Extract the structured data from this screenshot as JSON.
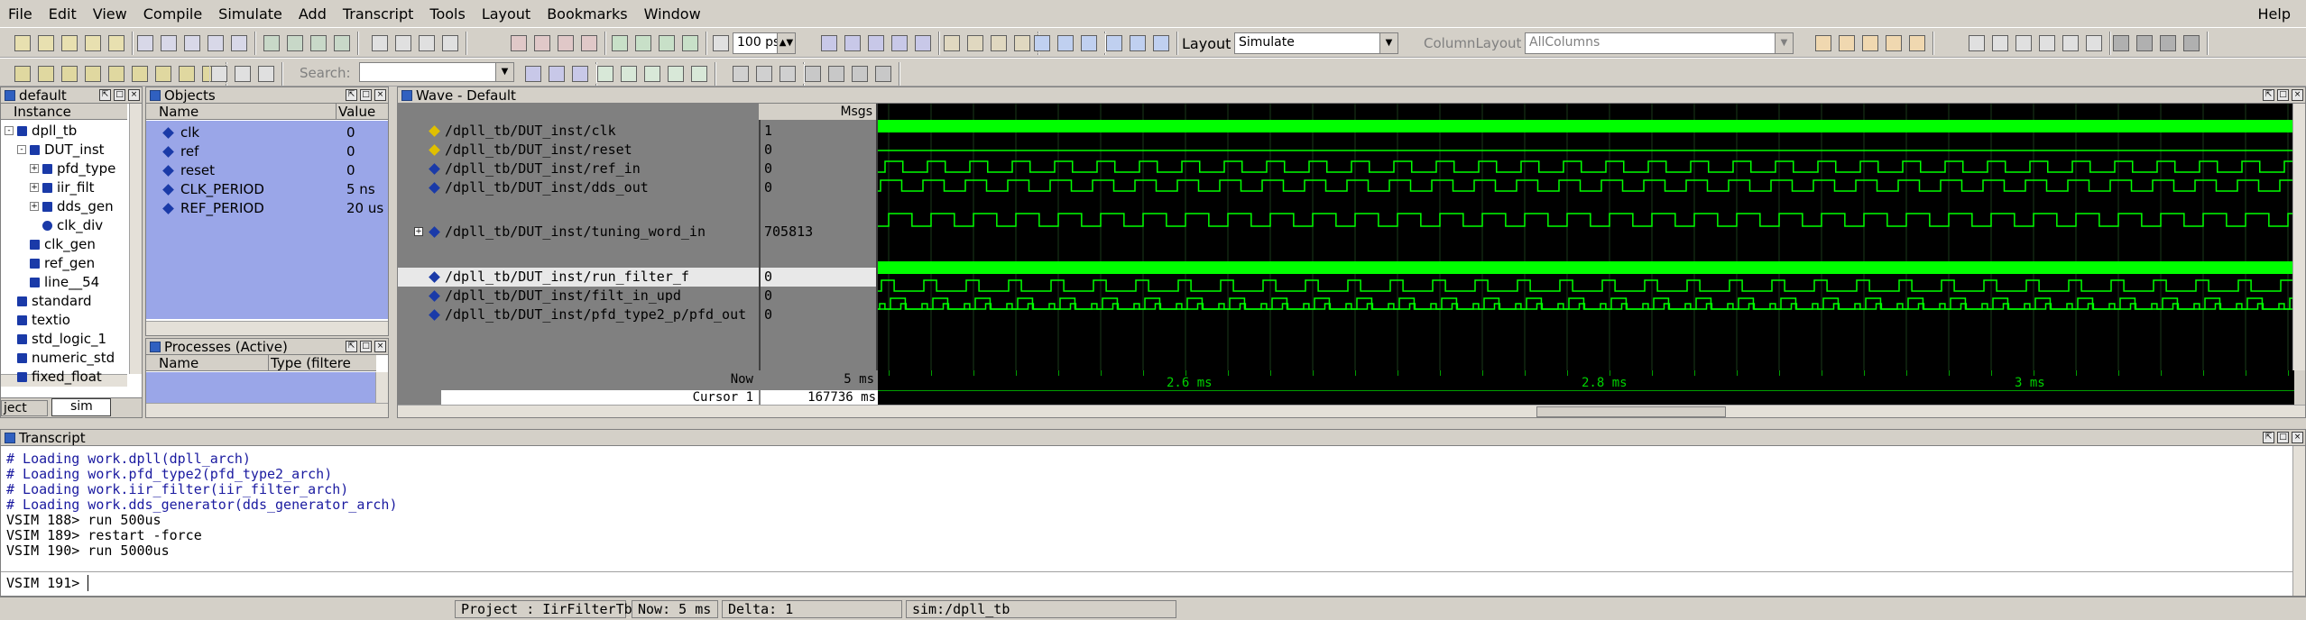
{
  "menu": [
    "File",
    "Edit",
    "View",
    "Compile",
    "Simulate",
    "Add",
    "Transcript",
    "Tools",
    "Layout",
    "Bookmarks",
    "Window"
  ],
  "menu_help": "Help",
  "toolbar": {
    "time_value": "100 ps",
    "layout_label": "Layout",
    "layout_value": "Simulate",
    "column_layout_label": "ColumnLayout",
    "column_layout_value": "AllColumns",
    "search_label": "Search:"
  },
  "instance_panel": {
    "title": "default",
    "col_instance": "Instance",
    "items": [
      {
        "label": "dpll_tb",
        "indent": 0,
        "expand": "-"
      },
      {
        "label": "DUT_inst",
        "indent": 1,
        "expand": "-"
      },
      {
        "label": "pfd_type",
        "indent": 2,
        "expand": "+"
      },
      {
        "label": "iir_filt",
        "indent": 2,
        "expand": "+"
      },
      {
        "label": "dds_gen",
        "indent": 2,
        "expand": "+"
      },
      {
        "label": "clk_div",
        "indent": 2,
        "expand": ""
      },
      {
        "label": "clk_gen",
        "indent": 1,
        "expand": ""
      },
      {
        "label": "ref_gen",
        "indent": 1,
        "expand": ""
      },
      {
        "label": "line__54",
        "indent": 1,
        "expand": ""
      },
      {
        "label": "standard",
        "indent": 0,
        "expand": ""
      },
      {
        "label": "textio",
        "indent": 0,
        "expand": ""
      },
      {
        "label": "std_logic_1",
        "indent": 0,
        "expand": ""
      },
      {
        "label": "numeric_std",
        "indent": 0,
        "expand": ""
      },
      {
        "label": "fixed_float",
        "indent": 0,
        "expand": ""
      }
    ],
    "tabs": [
      "ject",
      "sim"
    ]
  },
  "objects_panel": {
    "title": "Objects",
    "col_name": "Name",
    "col_value": "Value",
    "items": [
      {
        "name": "clk",
        "value": "0"
      },
      {
        "name": "ref",
        "value": "0"
      },
      {
        "name": "reset",
        "value": "0"
      },
      {
        "name": "CLK_PERIOD",
        "value": "5 ns"
      },
      {
        "name": "REF_PERIOD",
        "value": "20 us"
      }
    ]
  },
  "processes_panel": {
    "title": "Processes (Active)",
    "col_name": "Name",
    "col_type": "Type (filtere"
  },
  "wave_panel": {
    "title": "Wave - Default",
    "msgs_header": "Msgs",
    "signals": [
      {
        "path": "/dpll_tb/DUT_inst/clk",
        "value": "1"
      },
      {
        "path": "/dpll_tb/DUT_inst/reset",
        "value": "0"
      },
      {
        "path": "/dpll_tb/DUT_inst/ref_in",
        "value": "0"
      },
      {
        "path": "/dpll_tb/DUT_inst/dds_out",
        "value": "0"
      },
      {
        "path": "/dpll_tb/DUT_inst/tuning_word_in",
        "value": "705813"
      },
      {
        "path": "/dpll_tb/DUT_inst/run_filter_f",
        "value": "0"
      },
      {
        "path": "/dpll_tb/DUT_inst/filt_in_upd",
        "value": "0"
      },
      {
        "path": "/dpll_tb/DUT_inst/pfd_type2_p/pfd_out",
        "value": "0"
      }
    ],
    "now_label": "Now",
    "now_value": "5 ms",
    "cursor_label": "Cursor 1",
    "cursor_value": "167736 ms",
    "time_ticks": [
      "2.6 ms",
      "2.8 ms",
      "3 ms"
    ]
  },
  "transcript": {
    "title": "Transcript",
    "lines": [
      "# Loading work.dpll(dpll_arch)",
      "# Loading work.pfd_type2(pfd_type2_arch)",
      "# Loading work.iir_filter(iir_filter_arch)",
      "# Loading work.dds_generator(dds_generator_arch)",
      "VSIM 188> run 500us",
      "VSIM 189> restart -force",
      "VSIM 190> run 5000us"
    ],
    "prompt": "VSIM 191>"
  },
  "status": {
    "project": "Project : IirFilterTb",
    "now": "Now: 5 ms",
    "delta": "Delta: 1",
    "context": "sim:/dpll_tb"
  },
  "colors": {
    "wave_green": "#00ff00",
    "wave_bg": "#000000",
    "selection": "#9aa6e8",
    "signal_bg": "#808080"
  }
}
